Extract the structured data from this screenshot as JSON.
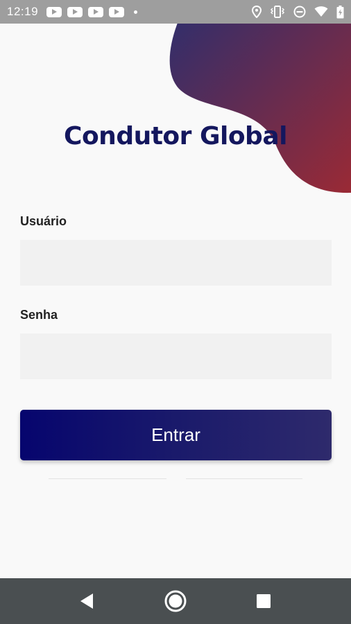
{
  "status_bar": {
    "time": "12:19",
    "notification_icons": [
      "youtube-icon",
      "youtube-icon",
      "youtube-icon",
      "youtube-icon",
      "dot-icon"
    ],
    "system_icons": [
      "location-icon",
      "vibrate-icon",
      "do-not-disturb-icon",
      "wifi-icon",
      "battery-icon"
    ]
  },
  "app": {
    "title": "Condutor Global"
  },
  "form": {
    "username_label": "Usuário",
    "username_value": "",
    "password_label": "Senha",
    "password_value": "",
    "submit_label": "Entrar"
  },
  "nav_bar": {
    "icons": [
      "back-icon",
      "home-icon",
      "recents-icon"
    ]
  },
  "colors": {
    "title": "#14175e",
    "button_start": "#06056e",
    "button_end": "#2e2a6c",
    "blob_start": "#2c2e6e",
    "blob_end": "#9a2a35",
    "field_bg": "#f1f1f1",
    "status_bar": "#9e9e9e",
    "nav_bar": "#4a4f51"
  }
}
